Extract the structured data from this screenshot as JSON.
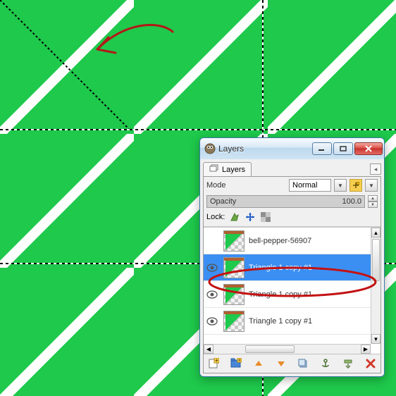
{
  "canvas": {
    "color": "#1ec94b",
    "grid": 3,
    "gap": 10
  },
  "dialog": {
    "title": "Layers",
    "tab_label": "Layers",
    "mode_label": "Mode",
    "mode_value": "Normal",
    "opacity_label": "Opacity",
    "opacity_value": "100.0",
    "lock_label": "Lock:"
  },
  "layers": [
    {
      "name": "bell-pepper-56907",
      "visible": false,
      "selected": false
    },
    {
      "name": "Triangle 1 copy #1",
      "visible": true,
      "selected": true
    },
    {
      "name": "Triangle 1 copy #1",
      "visible": true,
      "selected": false
    },
    {
      "name": "Triangle 1 copy #1",
      "visible": true,
      "selected": false
    }
  ]
}
